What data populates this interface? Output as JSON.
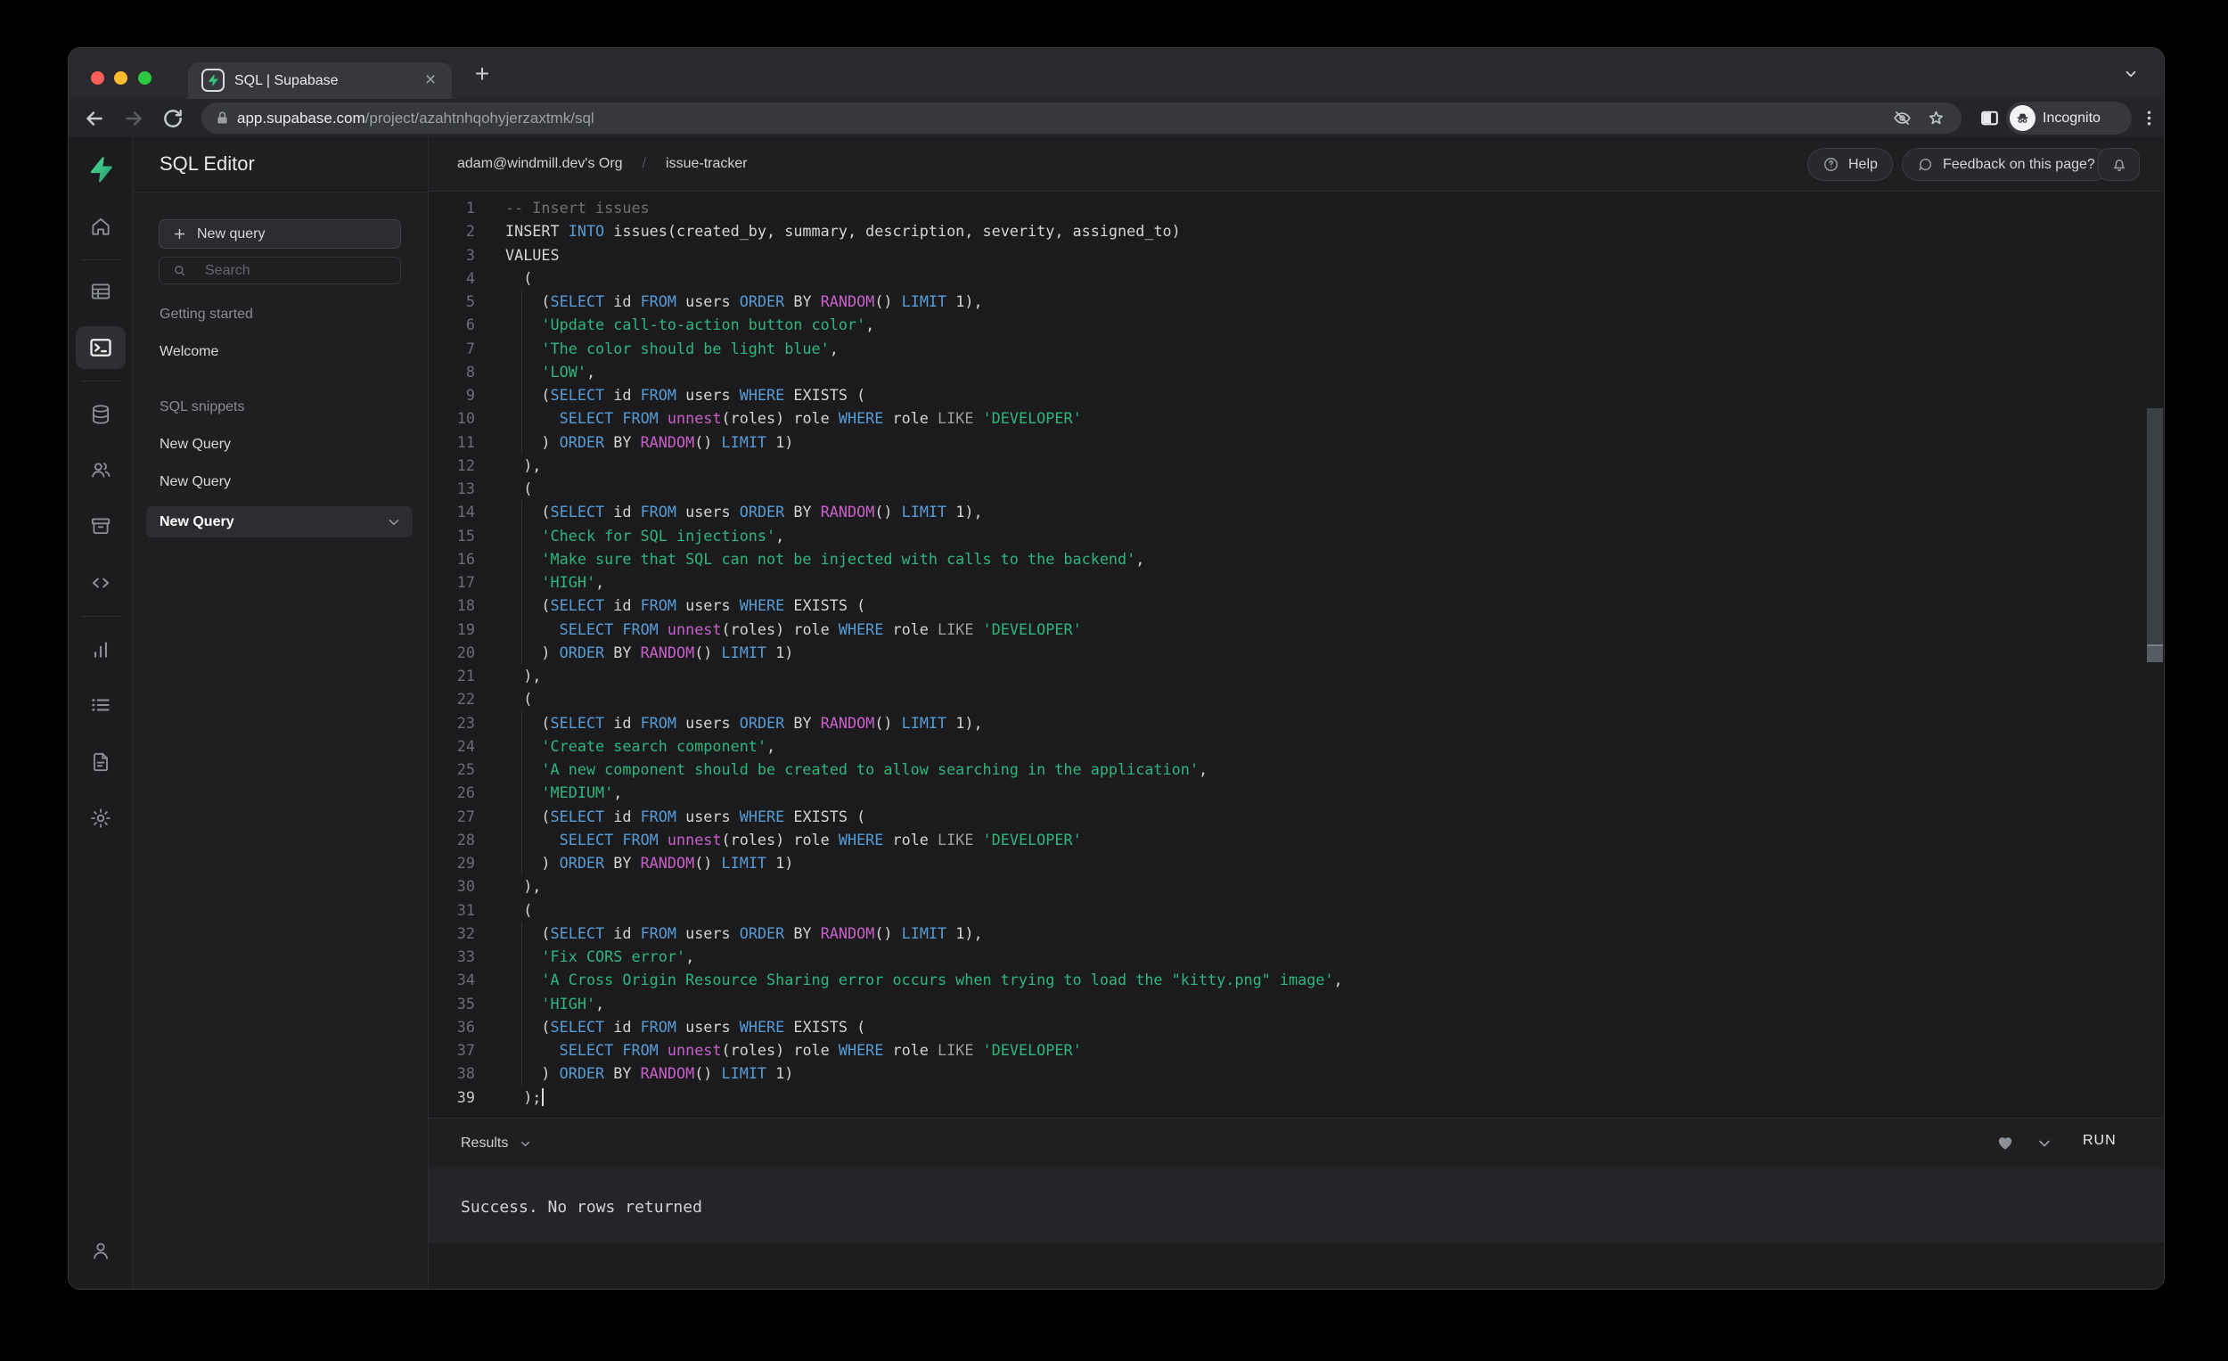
{
  "browser": {
    "tab_title": "SQL | Supabase",
    "url_domain": "app.supabase.com",
    "url_path": "/project/azahtnhqohyjerzaxtmk/sql",
    "incognito": "Incognito"
  },
  "rail_icons": [
    "supabase-logo",
    "home",
    "table-editor",
    "sql-editor",
    "database",
    "authentication",
    "storage",
    "api",
    "reports",
    "logs",
    "docs",
    "settings",
    "account"
  ],
  "sidebar": {
    "title": "SQL Editor",
    "new_query": "New query",
    "search_placeholder": "Search",
    "section_getting_started": "Getting started",
    "item_welcome": "Welcome",
    "section_snippets": "SQL snippets",
    "snippet_1": "New Query",
    "snippet_2": "New Query",
    "snippet_active": "New Query"
  },
  "header": {
    "org": "adam@windmill.dev's Org",
    "separator": "/",
    "project": "issue-tracker",
    "help": "Help",
    "feedback": "Feedback on this page?"
  },
  "results": {
    "label": "Results",
    "run": "RUN",
    "message": "Success. No rows returned"
  },
  "colors": {
    "accent_green": "#3ecf8e",
    "keyword": "#569cd6",
    "function": "#c95fc9",
    "string": "#2fb67c",
    "comment": "#6f6f6f",
    "operator": "#9d9d9d"
  },
  "editor": {
    "cursor_line": 39,
    "lines": [
      [
        [
          "-- Insert issues",
          "c"
        ]
      ],
      [
        [
          "INSERT ",
          "d"
        ],
        [
          "INTO",
          "k"
        ],
        [
          " issues(created_by, summary, description, severity, assigned_to)",
          "d"
        ]
      ],
      [
        [
          "VALUES",
          "d"
        ]
      ],
      [
        [
          "  (",
          "d"
        ]
      ],
      [
        [
          "    (",
          "d"
        ],
        [
          "SELECT",
          "k"
        ],
        [
          " id ",
          "d"
        ],
        [
          "FROM",
          "k"
        ],
        [
          " users ",
          "d"
        ],
        [
          "ORDER",
          "k"
        ],
        [
          " BY ",
          "d"
        ],
        [
          "RANDOM",
          "f"
        ],
        [
          "() ",
          "d"
        ],
        [
          "LIMIT",
          "k"
        ],
        [
          " 1),",
          "d"
        ]
      ],
      [
        [
          "    ",
          "d"
        ],
        [
          "'Update call-to-action button color'",
          "s"
        ],
        [
          ",",
          "d"
        ]
      ],
      [
        [
          "    ",
          "d"
        ],
        [
          "'The color should be light blue'",
          "s"
        ],
        [
          ",",
          "d"
        ]
      ],
      [
        [
          "    ",
          "d"
        ],
        [
          "'LOW'",
          "s"
        ],
        [
          ",",
          "d"
        ]
      ],
      [
        [
          "    (",
          "d"
        ],
        [
          "SELECT",
          "k"
        ],
        [
          " id ",
          "d"
        ],
        [
          "FROM",
          "k"
        ],
        [
          " users ",
          "d"
        ],
        [
          "WHERE",
          "k"
        ],
        [
          " EXISTS (",
          "d"
        ]
      ],
      [
        [
          "      ",
          "d"
        ],
        [
          "SELECT",
          "k"
        ],
        [
          " ",
          "d"
        ],
        [
          "FROM",
          "k"
        ],
        [
          " ",
          "d"
        ],
        [
          "unnest",
          "f"
        ],
        [
          "(roles) role ",
          "d"
        ],
        [
          "WHERE",
          "k"
        ],
        [
          " role ",
          "d"
        ],
        [
          "LIKE",
          "o"
        ],
        [
          " ",
          "d"
        ],
        [
          "'DEVELOPER'",
          "s"
        ]
      ],
      [
        [
          "    ) ",
          "d"
        ],
        [
          "ORDER",
          "k"
        ],
        [
          " BY ",
          "d"
        ],
        [
          "RANDOM",
          "f"
        ],
        [
          "() ",
          "d"
        ],
        [
          "LIMIT",
          "k"
        ],
        [
          " 1)",
          "d"
        ]
      ],
      [
        [
          "  ),",
          "d"
        ]
      ],
      [
        [
          "  (",
          "d"
        ]
      ],
      [
        [
          "    (",
          "d"
        ],
        [
          "SELECT",
          "k"
        ],
        [
          " id ",
          "d"
        ],
        [
          "FROM",
          "k"
        ],
        [
          " users ",
          "d"
        ],
        [
          "ORDER",
          "k"
        ],
        [
          " BY ",
          "d"
        ],
        [
          "RANDOM",
          "f"
        ],
        [
          "() ",
          "d"
        ],
        [
          "LIMIT",
          "k"
        ],
        [
          " 1),",
          "d"
        ]
      ],
      [
        [
          "    ",
          "d"
        ],
        [
          "'Check for SQL injections'",
          "s"
        ],
        [
          ",",
          "d"
        ]
      ],
      [
        [
          "    ",
          "d"
        ],
        [
          "'Make sure that SQL can not be injected with calls to the backend'",
          "s"
        ],
        [
          ",",
          "d"
        ]
      ],
      [
        [
          "    ",
          "d"
        ],
        [
          "'HIGH'",
          "s"
        ],
        [
          ",",
          "d"
        ]
      ],
      [
        [
          "    (",
          "d"
        ],
        [
          "SELECT",
          "k"
        ],
        [
          " id ",
          "d"
        ],
        [
          "FROM",
          "k"
        ],
        [
          " users ",
          "d"
        ],
        [
          "WHERE",
          "k"
        ],
        [
          " EXISTS (",
          "d"
        ]
      ],
      [
        [
          "      ",
          "d"
        ],
        [
          "SELECT",
          "k"
        ],
        [
          " ",
          "d"
        ],
        [
          "FROM",
          "k"
        ],
        [
          " ",
          "d"
        ],
        [
          "unnest",
          "f"
        ],
        [
          "(roles) role ",
          "d"
        ],
        [
          "WHERE",
          "k"
        ],
        [
          " role ",
          "d"
        ],
        [
          "LIKE",
          "o"
        ],
        [
          " ",
          "d"
        ],
        [
          "'DEVELOPER'",
          "s"
        ]
      ],
      [
        [
          "    ) ",
          "d"
        ],
        [
          "ORDER",
          "k"
        ],
        [
          " BY ",
          "d"
        ],
        [
          "RANDOM",
          "f"
        ],
        [
          "() ",
          "d"
        ],
        [
          "LIMIT",
          "k"
        ],
        [
          " 1)",
          "d"
        ]
      ],
      [
        [
          "  ),",
          "d"
        ]
      ],
      [
        [
          "  (",
          "d"
        ]
      ],
      [
        [
          "    (",
          "d"
        ],
        [
          "SELECT",
          "k"
        ],
        [
          " id ",
          "d"
        ],
        [
          "FROM",
          "k"
        ],
        [
          " users ",
          "d"
        ],
        [
          "ORDER",
          "k"
        ],
        [
          " BY ",
          "d"
        ],
        [
          "RANDOM",
          "f"
        ],
        [
          "() ",
          "d"
        ],
        [
          "LIMIT",
          "k"
        ],
        [
          " 1),",
          "d"
        ]
      ],
      [
        [
          "    ",
          "d"
        ],
        [
          "'Create search component'",
          "s"
        ],
        [
          ",",
          "d"
        ]
      ],
      [
        [
          "    ",
          "d"
        ],
        [
          "'A new component should be created to allow searching in the application'",
          "s"
        ],
        [
          ",",
          "d"
        ]
      ],
      [
        [
          "    ",
          "d"
        ],
        [
          "'MEDIUM'",
          "s"
        ],
        [
          ",",
          "d"
        ]
      ],
      [
        [
          "    (",
          "d"
        ],
        [
          "SELECT",
          "k"
        ],
        [
          " id ",
          "d"
        ],
        [
          "FROM",
          "k"
        ],
        [
          " users ",
          "d"
        ],
        [
          "WHERE",
          "k"
        ],
        [
          " EXISTS (",
          "d"
        ]
      ],
      [
        [
          "      ",
          "d"
        ],
        [
          "SELECT",
          "k"
        ],
        [
          " ",
          "d"
        ],
        [
          "FROM",
          "k"
        ],
        [
          " ",
          "d"
        ],
        [
          "unnest",
          "f"
        ],
        [
          "(roles) role ",
          "d"
        ],
        [
          "WHERE",
          "k"
        ],
        [
          " role ",
          "d"
        ],
        [
          "LIKE",
          "o"
        ],
        [
          " ",
          "d"
        ],
        [
          "'DEVELOPER'",
          "s"
        ]
      ],
      [
        [
          "    ) ",
          "d"
        ],
        [
          "ORDER",
          "k"
        ],
        [
          " BY ",
          "d"
        ],
        [
          "RANDOM",
          "f"
        ],
        [
          "() ",
          "d"
        ],
        [
          "LIMIT",
          "k"
        ],
        [
          " 1)",
          "d"
        ]
      ],
      [
        [
          "  ),",
          "d"
        ]
      ],
      [
        [
          "  (",
          "d"
        ]
      ],
      [
        [
          "    (",
          "d"
        ],
        [
          "SELECT",
          "k"
        ],
        [
          " id ",
          "d"
        ],
        [
          "FROM",
          "k"
        ],
        [
          " users ",
          "d"
        ],
        [
          "ORDER",
          "k"
        ],
        [
          " BY ",
          "d"
        ],
        [
          "RANDOM",
          "f"
        ],
        [
          "() ",
          "d"
        ],
        [
          "LIMIT",
          "k"
        ],
        [
          " 1),",
          "d"
        ]
      ],
      [
        [
          "    ",
          "d"
        ],
        [
          "'Fix CORS error'",
          "s"
        ],
        [
          ",",
          "d"
        ]
      ],
      [
        [
          "    ",
          "d"
        ],
        [
          "'A Cross Origin Resource Sharing error occurs when trying to load the \"kitty.png\" image'",
          "s"
        ],
        [
          ",",
          "d"
        ]
      ],
      [
        [
          "    ",
          "d"
        ],
        [
          "'HIGH'",
          "s"
        ],
        [
          ",",
          "d"
        ]
      ],
      [
        [
          "    (",
          "d"
        ],
        [
          "SELECT",
          "k"
        ],
        [
          " id ",
          "d"
        ],
        [
          "FROM",
          "k"
        ],
        [
          " users ",
          "d"
        ],
        [
          "WHERE",
          "k"
        ],
        [
          " EXISTS (",
          "d"
        ]
      ],
      [
        [
          "      ",
          "d"
        ],
        [
          "SELECT",
          "k"
        ],
        [
          " ",
          "d"
        ],
        [
          "FROM",
          "k"
        ],
        [
          " ",
          "d"
        ],
        [
          "unnest",
          "f"
        ],
        [
          "(roles) role ",
          "d"
        ],
        [
          "WHERE",
          "k"
        ],
        [
          " role ",
          "d"
        ],
        [
          "LIKE",
          "o"
        ],
        [
          " ",
          "d"
        ],
        [
          "'DEVELOPER'",
          "s"
        ]
      ],
      [
        [
          "    ) ",
          "d"
        ],
        [
          "ORDER",
          "k"
        ],
        [
          " BY ",
          "d"
        ],
        [
          "RANDOM",
          "f"
        ],
        [
          "() ",
          "d"
        ],
        [
          "LIMIT",
          "k"
        ],
        [
          " 1)",
          "d"
        ]
      ],
      [
        [
          "  );",
          "d"
        ]
      ]
    ]
  }
}
